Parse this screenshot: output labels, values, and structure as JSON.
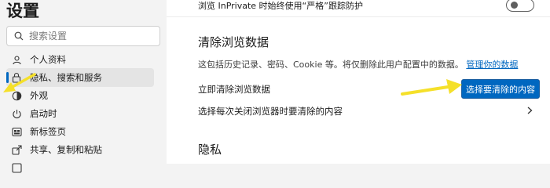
{
  "sidebar": {
    "title": "设置",
    "search": {
      "placeholder": "搜索设置"
    },
    "items": [
      {
        "label": "个人资料",
        "icon": "profile-icon",
        "active": false
      },
      {
        "label": "隐私、搜索和服务",
        "icon": "lock-icon",
        "active": true
      },
      {
        "label": "外观",
        "icon": "appearance-icon",
        "active": false
      },
      {
        "label": "启动时",
        "icon": "power-icon",
        "active": false
      },
      {
        "label": "新标签页",
        "icon": "new-tab-icon",
        "active": false
      },
      {
        "label": "共享、复制和粘贴",
        "icon": "share-icon",
        "active": false
      }
    ]
  },
  "main": {
    "inprivate_row": {
      "label": "浏览 InPrivate 时始终使用“严格”跟踪防护",
      "toggle_on": false
    },
    "clear_section": {
      "title": "清除浏览数据",
      "description": "这包括历史记录、密码、Cookie 等。将仅删除此用户配置中的数据。",
      "manage_link": "管理你的数据",
      "clear_now_label": "立即清除浏览数据",
      "choose_button": "选择要清除的内容",
      "on_close_label": "选择每次关闭浏览器时要清除的内容"
    },
    "privacy_section": {
      "title": "隐私"
    }
  },
  "colors": {
    "accent": "#0067c0",
    "annotation": "#f5e02a"
  }
}
